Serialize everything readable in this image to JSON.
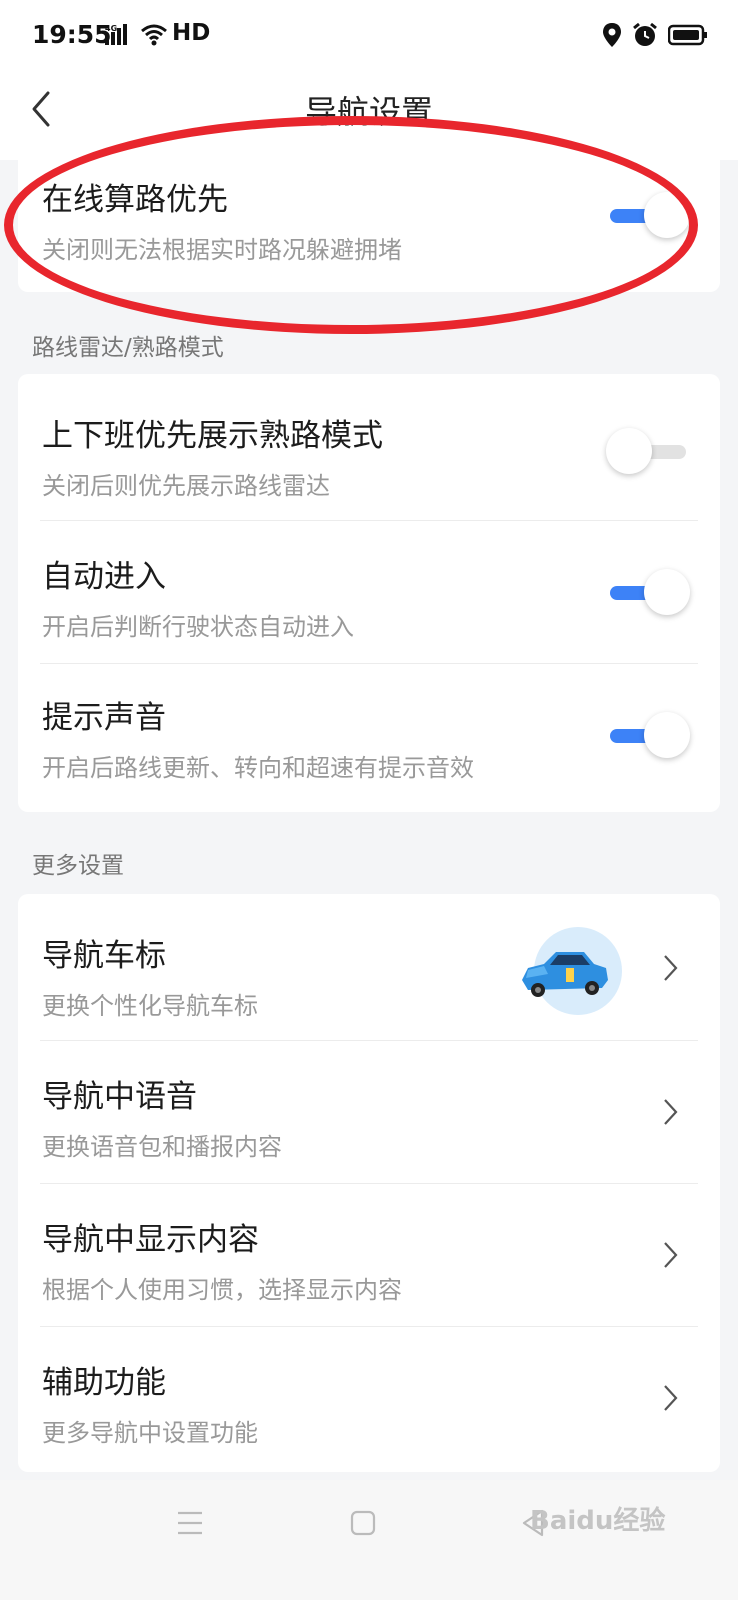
{
  "status_bar": {
    "time": "19:55",
    "network": "4G",
    "hd": "HD"
  },
  "header": {
    "title": "导航设置"
  },
  "online_route": {
    "title": "在线算路优先",
    "subtitle": "关闭则无法根据实时路况躲避拥堵",
    "enabled": true
  },
  "radar_section": {
    "label": "路线雷达/熟路模式",
    "items": [
      {
        "title": "上下班优先展示熟路模式",
        "subtitle": "关闭后则优先展示路线雷达",
        "enabled": false
      },
      {
        "title": "自动进入",
        "subtitle": "开启后判断行驶状态自动进入",
        "enabled": true
      },
      {
        "title": "提示声音",
        "subtitle": "开启后路线更新、转向和超速有提示音效",
        "enabled": true
      }
    ]
  },
  "more_section": {
    "label": "更多设置",
    "items": [
      {
        "title": "导航车标",
        "subtitle": "更换个性化导航车标"
      },
      {
        "title": "导航中语音",
        "subtitle": "更换语音包和播报内容"
      },
      {
        "title": "导航中显示内容",
        "subtitle": "根据个人使用习惯，选择显示内容"
      },
      {
        "title": "辅助功能",
        "subtitle": "更多导航中设置功能"
      }
    ]
  },
  "watermark": "Baidu经验",
  "colors": {
    "accent": "#3d82f7",
    "highlight": "#e8262d",
    "background": "#f4f5f7"
  },
  "icons": [
    "back-arrow-icon",
    "signal-icon",
    "wifi-icon",
    "location-icon",
    "alarm-icon",
    "battery-icon",
    "chevron-right-icon",
    "car-icon",
    "menu-icon",
    "home-icon",
    "back-nav-icon"
  ]
}
